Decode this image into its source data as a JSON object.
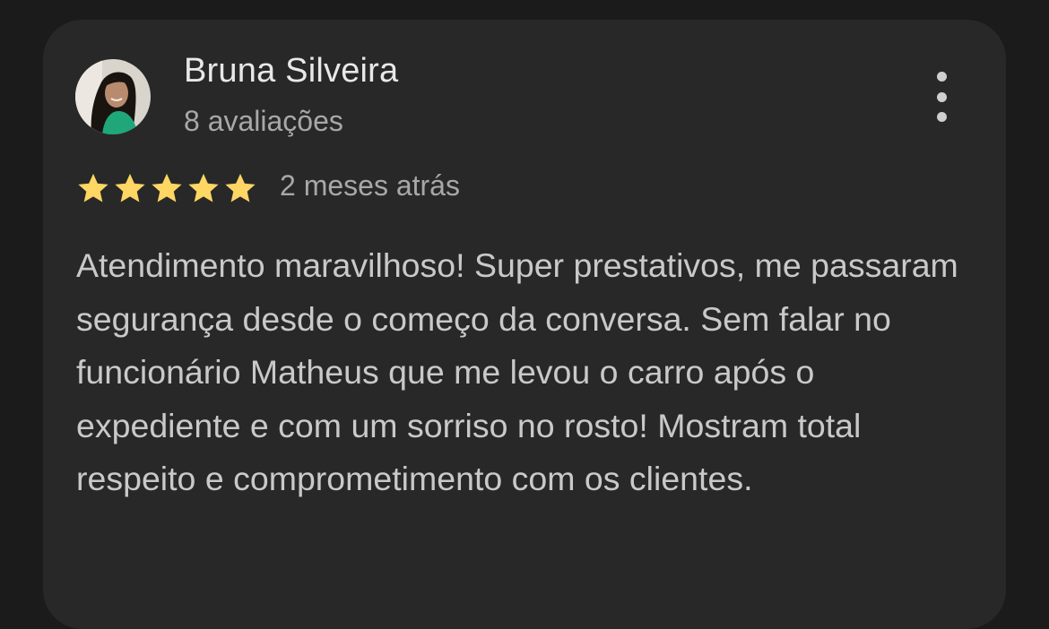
{
  "review": {
    "author": {
      "name": "Bruna Silveira",
      "reviews_count": "8 avaliações",
      "avatar_icon": "profile-photo"
    },
    "menu_icon": "more-vert-icon",
    "rating": 5,
    "rating_max": 5,
    "star_color": "#fdd663",
    "time_ago": "2 meses atrás",
    "text": "Atendimento maravilhoso! Super prestativos, me passaram segurança desde o começo da conversa. Sem falar no funcionário Matheus que me levou o carro após o expediente e com um sorriso no rosto! Mostram total respeito e comprometimento com os clientes."
  }
}
